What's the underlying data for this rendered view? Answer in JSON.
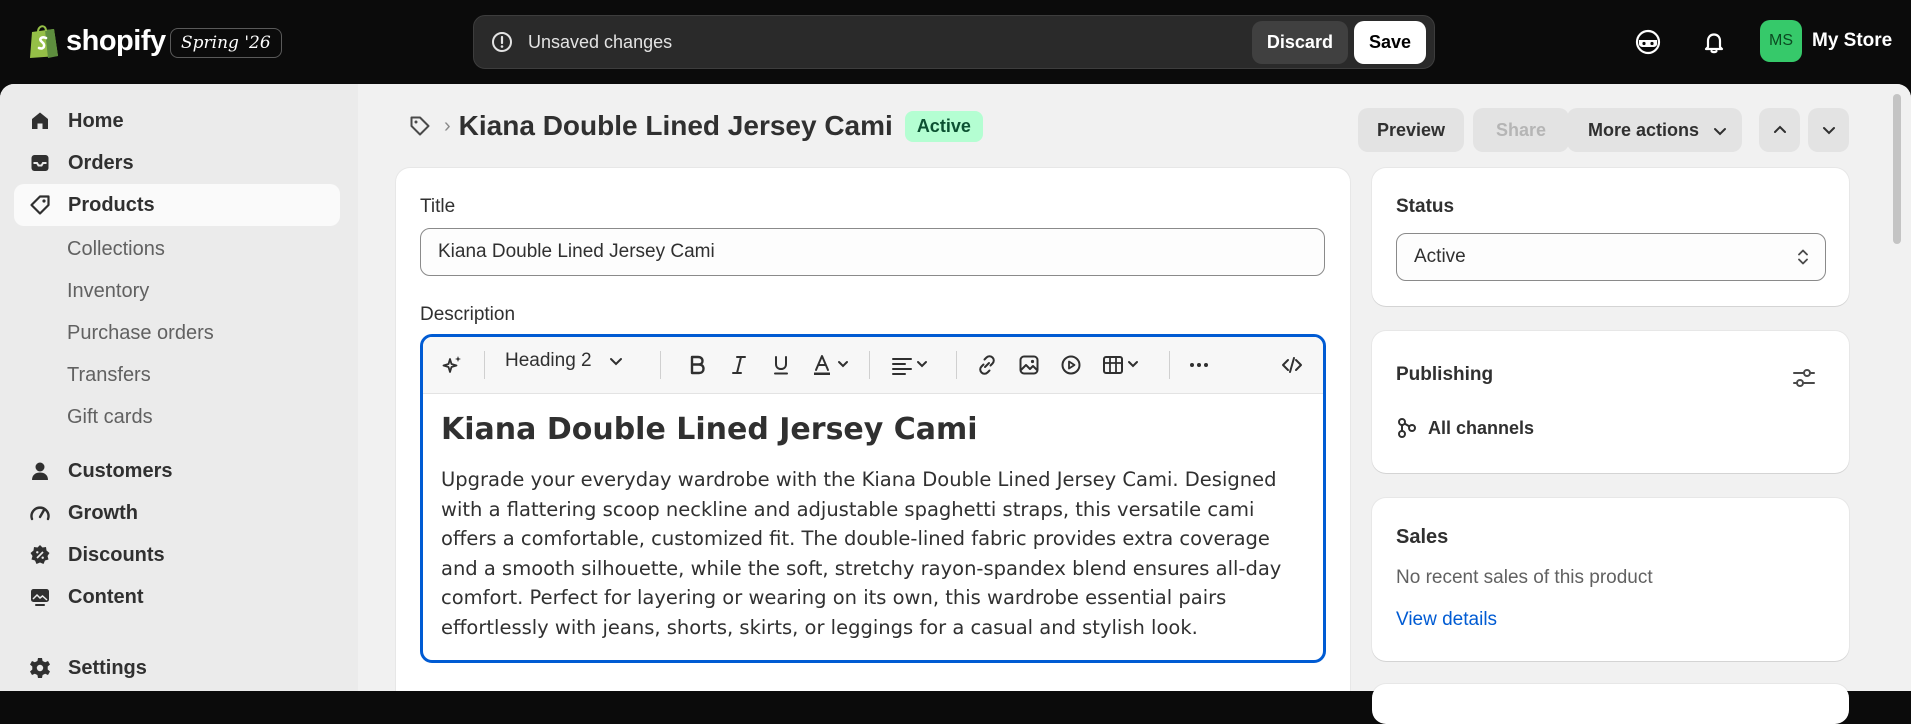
{
  "topbar": {
    "brand": "shopify",
    "edition": "Spring '26",
    "unsaved_text": "Unsaved changes",
    "discard_label": "Discard",
    "save_label": "Save",
    "avatar_initials": "MS",
    "store_name": "My Store",
    "icons": [
      "alert-icon",
      "sidekick-icon",
      "bell-icon"
    ]
  },
  "sidebar": {
    "items": [
      {
        "label": "Home",
        "icon": "home-icon"
      },
      {
        "label": "Orders",
        "icon": "inbox-icon"
      },
      {
        "label": "Products",
        "icon": "tag-icon"
      },
      {
        "label": "Customers",
        "icon": "person-icon"
      },
      {
        "label": "Growth",
        "icon": "gauge-icon"
      },
      {
        "label": "Discounts",
        "icon": "discount-icon"
      },
      {
        "label": "Content",
        "icon": "content-icon"
      },
      {
        "label": "Settings",
        "icon": "gear-icon"
      }
    ],
    "sub_items": [
      "Collections",
      "Inventory",
      "Purchase orders",
      "Transfers",
      "Gift cards"
    ]
  },
  "header": {
    "separator": "›",
    "title": "Kiana Double Lined Jersey Cami",
    "status_badge": "Active",
    "preview_label": "Preview",
    "share_label": "Share",
    "more_actions_label": "More actions"
  },
  "product": {
    "title_label": "Title",
    "title_value": "Kiana Double Lined Jersey Cami",
    "description_label": "Description",
    "heading_style": "Heading 2",
    "description_heading": "Kiana Double Lined Jersey Cami",
    "description_body": "Upgrade your everyday wardrobe with the Kiana Double Lined Jersey Cami. Designed with a flattering scoop neckline and adjustable spaghetti straps, this versatile cami offers a comfortable, customized fit. The double-lined fabric provides extra coverage and a smooth silhouette, while the soft, stretchy rayon-spandex blend ensures all-day comfort. Perfect for layering or wearing on its own, this wardrobe essential pairs effortlessly with jeans, shorts, skirts, or leggings for a casual and stylish look."
  },
  "status_card": {
    "label": "Status",
    "value": "Active"
  },
  "publishing_card": {
    "label": "Publishing",
    "channels": "All channels"
  },
  "sales_card": {
    "label": "Sales",
    "text": "No recent sales of this product",
    "link": "View details"
  },
  "colors": {
    "accent": "#005bd3",
    "active_badge_bg": "#b4fed2",
    "avatar_bg": "#36c96a",
    "link": "#005bd3"
  }
}
